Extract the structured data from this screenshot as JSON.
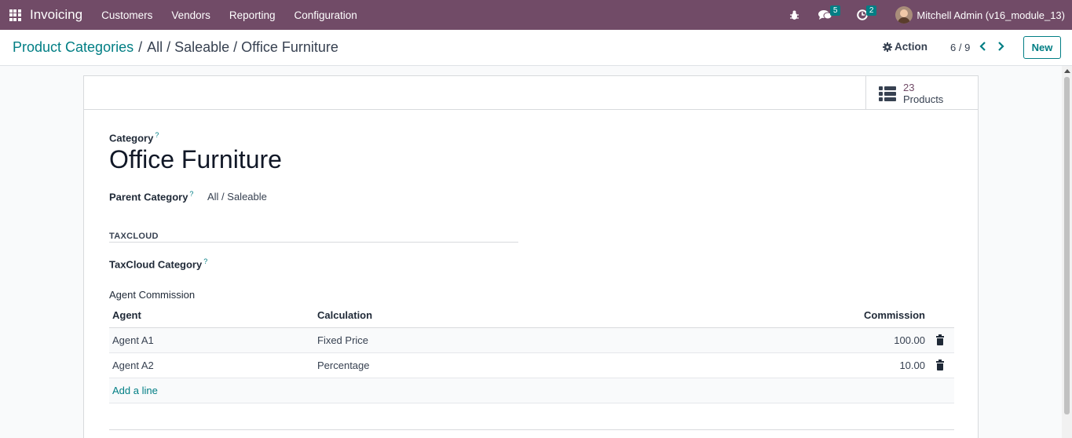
{
  "navbar": {
    "app_name": "Invoicing",
    "menu": [
      "Customers",
      "Vendors",
      "Reporting",
      "Configuration"
    ],
    "messages_count": "5",
    "activities_count": "2",
    "user_name": "Mitchell Admin (v16_module_13)"
  },
  "control": {
    "breadcrumb_root": "Product Categories",
    "breadcrumb_sep": "/",
    "breadcrumb_current": "All / Saleable / Office Furniture",
    "action_label": "Action",
    "pager": "6 / 9",
    "new_label": "New"
  },
  "stat_button": {
    "value": "23",
    "label": "Products"
  },
  "form": {
    "category_label": "Category",
    "help_mark": "?",
    "category_name": "Office Furniture",
    "parent_label": "Parent Category",
    "parent_value": "All / Saleable",
    "taxcloud_section": "TAXCLOUD",
    "taxcloud_label": "TaxCloud Category",
    "commission_section": "Agent Commission"
  },
  "commission_table": {
    "headers": {
      "agent": "Agent",
      "calculation": "Calculation",
      "commission": "Commission"
    },
    "rows": [
      {
        "agent": "Agent A1",
        "calculation": "Fixed Price",
        "commission": "100.00"
      },
      {
        "agent": "Agent A2",
        "calculation": "Percentage",
        "commission": "10.00"
      }
    ],
    "add_line": "Add a line"
  },
  "colors": {
    "navbar": "#714b67",
    "accent": "#017e84"
  },
  "icons": [
    "apps-grid-icon",
    "bug-icon",
    "chat-icon",
    "clock-icon",
    "gear-icon",
    "chevron-left-icon",
    "chevron-right-icon",
    "list-icon",
    "trash-icon"
  ]
}
